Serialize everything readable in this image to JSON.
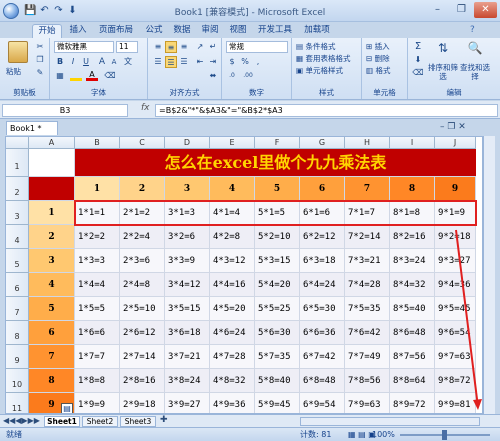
{
  "window": {
    "title": "Book1 [兼容模式] - Microsoft Excel",
    "minimize": "–",
    "restore": "❐",
    "close": "✕"
  },
  "quick_access": [
    "💾",
    "↶",
    "↷",
    "⬇"
  ],
  "ribbon_tabs": [
    "开始",
    "插入",
    "页面布局",
    "公式",
    "数据",
    "审阅",
    "视图",
    "开发工具",
    "加载项"
  ],
  "ribbon": {
    "clipboard": {
      "paste": "粘贴",
      "label": "剪贴板"
    },
    "font": {
      "name": "微软雅黑",
      "size": "11",
      "label": "字体",
      "bold": "B",
      "italic": "I",
      "underline": "U",
      "grow": "A",
      "shrink": "A",
      "wen": "文"
    },
    "alignment": {
      "label": "对齐方式"
    },
    "number": {
      "format": "常规",
      "label": "数字",
      "pct": "%",
      "comma": ",",
      "currency": "$",
      "inc_dec": ".0",
      "dec_dec": ".00"
    },
    "styles": {
      "cond_format": "条件格式",
      "table_format": "套用表格格式",
      "cell_style": "单元格样式",
      "label": "样式"
    },
    "cells": {
      "insert": "插入",
      "delete": "删除",
      "format": "格式",
      "label": "单元格"
    },
    "editing": {
      "sum": "Σ",
      "sort": "排序和筛选",
      "find": "查找和选择",
      "label": "编辑"
    }
  },
  "formula_bar": {
    "namebox": "B3",
    "fx": "fx",
    "formula": "=B$2&\"*\"&$A3&\"=\"&B$2*$A3"
  },
  "workbook_tab": "Book1 *",
  "columns": [
    "A",
    "B",
    "C",
    "D",
    "E",
    "F",
    "G",
    "H",
    "I",
    "J"
  ],
  "rows": [
    "1",
    "2",
    "3",
    "4",
    "5",
    "6",
    "7",
    "8",
    "9",
    "10",
    "11"
  ],
  "sheet": {
    "title": "怎么在excel里做个九九乘法表",
    "header_numbers": [
      "1",
      "2",
      "3",
      "4",
      "5",
      "6",
      "7",
      "8",
      "9"
    ],
    "row_labels": [
      "1",
      "2",
      "3",
      "4",
      "5",
      "6",
      "7",
      "8",
      "9"
    ],
    "header_colors": [
      "#ffe1a6",
      "#ffd38a",
      "#ffc870",
      "#ffbb5c",
      "#ffad4a",
      "#ffa03c",
      "#ff9330",
      "#ff8726",
      "#fb7b1c"
    ],
    "row_colors": [
      "#ffe1a6",
      "#ffd38a",
      "#ffc870",
      "#ffbb5c",
      "#ffad4a",
      "#ffa03c",
      "#ff9330",
      "#ff8726",
      "#fb7b1c"
    ],
    "table": [
      [
        "1*1=1",
        "2*1=2",
        "3*1=3",
        "4*1=4",
        "5*1=5",
        "6*1=6",
        "7*1=7",
        "8*1=8",
        "9*1=9"
      ],
      [
        "1*2=2",
        "2*2=4",
        "3*2=6",
        "4*2=8",
        "5*2=10",
        "6*2=12",
        "7*2=14",
        "8*2=16",
        "9*2=18"
      ],
      [
        "1*3=3",
        "2*3=6",
        "3*3=9",
        "4*3=12",
        "5*3=15",
        "6*3=18",
        "7*3=21",
        "8*3=24",
        "9*3=27"
      ],
      [
        "1*4=4",
        "2*4=8",
        "3*4=12",
        "4*4=16",
        "5*4=20",
        "6*4=24",
        "7*4=28",
        "8*4=32",
        "9*4=36"
      ],
      [
        "1*5=5",
        "2*5=10",
        "3*5=15",
        "4*5=20",
        "5*5=25",
        "6*5=30",
        "7*5=35",
        "8*5=40",
        "9*5=45"
      ],
      [
        "1*6=6",
        "2*6=12",
        "3*6=18",
        "4*6=24",
        "5*6=30",
        "6*6=36",
        "7*6=42",
        "8*6=48",
        "9*6=54"
      ],
      [
        "1*7=7",
        "2*7=14",
        "3*7=21",
        "4*7=28",
        "5*7=35",
        "6*7=42",
        "7*7=49",
        "8*7=56",
        "9*7=63"
      ],
      [
        "1*8=8",
        "2*8=16",
        "3*8=24",
        "4*8=32",
        "5*8=40",
        "6*8=48",
        "7*8=56",
        "8*8=64",
        "9*8=72"
      ],
      [
        "1*9=9",
        "2*9=18",
        "3*9=27",
        "4*9=36",
        "5*9=45",
        "6*9=54",
        "7*9=63",
        "8*9=72",
        "9*9=81"
      ]
    ]
  },
  "sheet_tabs": [
    "Sheet1",
    "Sheet2",
    "Sheet3"
  ],
  "status": {
    "mode": "就绪",
    "count": "计数: 81",
    "zoom": "100%"
  },
  "colors": {
    "title_bg": "#c00000",
    "title_fg": "#ffd400",
    "highlight": "#e02020",
    "corner": "#c00000"
  }
}
